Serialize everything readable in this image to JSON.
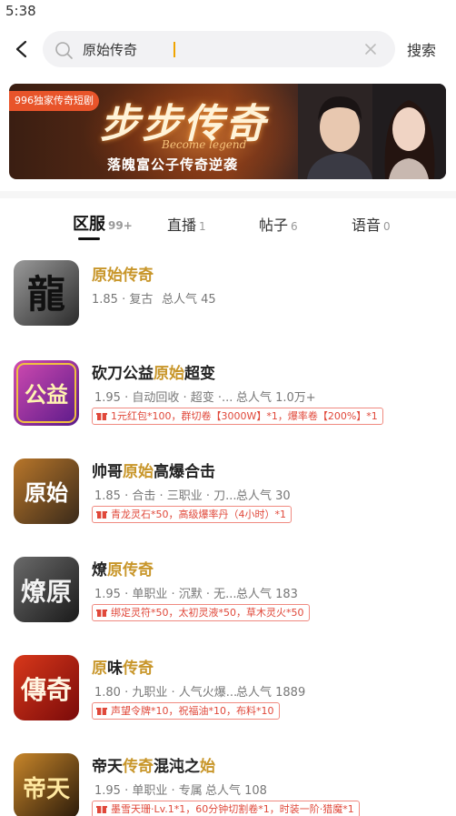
{
  "status": {
    "time": "5:38"
  },
  "search": {
    "query": "原始传奇",
    "button_label": "搜索"
  },
  "banner": {
    "tag": "996独家传奇短剧",
    "title": "步步传奇",
    "subtitle_en": "Become legend",
    "subtitle": "落魄富公子传奇逆袭"
  },
  "tabs": [
    {
      "label": "区服",
      "count": "99+"
    },
    {
      "label": "直播",
      "count": "1"
    },
    {
      "label": "帖子",
      "count": "6"
    },
    {
      "label": "语音",
      "count": "0"
    }
  ],
  "games": [
    {
      "title_parts": [
        "",
        "原始传奇",
        ""
      ],
      "meta": "1.85 · 复古",
      "popularity": "总人气 45",
      "gift": "",
      "icon_text": "龍",
      "icon_colors": [
        "#2b2b2b",
        "#7a7a7a"
      ]
    },
    {
      "title_parts": [
        "砍刀公益",
        "原始",
        "超变"
      ],
      "meta": "1.95 · 自动回收 · 超变 ·...",
      "popularity": "总人气 1.0万+",
      "gift": "1元红包*100，群切卷【3000W】*1，爆率卷【200%】*1",
      "icon_text": "公益",
      "icon_colors": [
        "#5a1a8a",
        "#d04ab0"
      ]
    },
    {
      "title_parts": [
        "帅哥",
        "原始",
        "高爆合击"
      ],
      "meta": "1.85 · 合击 · 三职业 · 刀...",
      "popularity": "总人气 30",
      "gift": "青龙灵石*50，高级爆率丹（4小时）*1",
      "icon_text": "原始",
      "icon_colors": [
        "#3a2a1a",
        "#b8762a"
      ]
    },
    {
      "title_parts": [
        "燎",
        "原传奇",
        ""
      ],
      "meta": "1.95 · 单职业 · 沉默 · 无...",
      "popularity": "总人气 183",
      "gift": "绑定灵符*50，太初灵液*50，草木灵火*50",
      "icon_text": "燎原",
      "icon_colors": [
        "#1a1a1a",
        "#6a6a6a"
      ]
    },
    {
      "title_parts": [
        "原",
        "味",
        "传奇"
      ],
      "meta": "1.80 · 九职业 · 人气火爆...",
      "popularity": "总人气 1889",
      "gift": "声望令牌*10，祝福油*10，布料*10",
      "icon_text": "傳奇",
      "icon_colors": [
        "#7a0a0a",
        "#d8381a"
      ]
    },
    {
      "title_parts": [
        "帝天",
        "传奇",
        "混沌之",
        "始"
      ],
      "meta": "1.95 · 单职业 · 专属",
      "popularity": "总人气 108",
      "gift": "墨雪天珊·Lv.1*1，60分钟切割卷*1，时装一阶·猎魔*1",
      "icon_text": "帝天",
      "icon_colors": [
        "#2a1a0a",
        "#c8862a"
      ]
    }
  ]
}
